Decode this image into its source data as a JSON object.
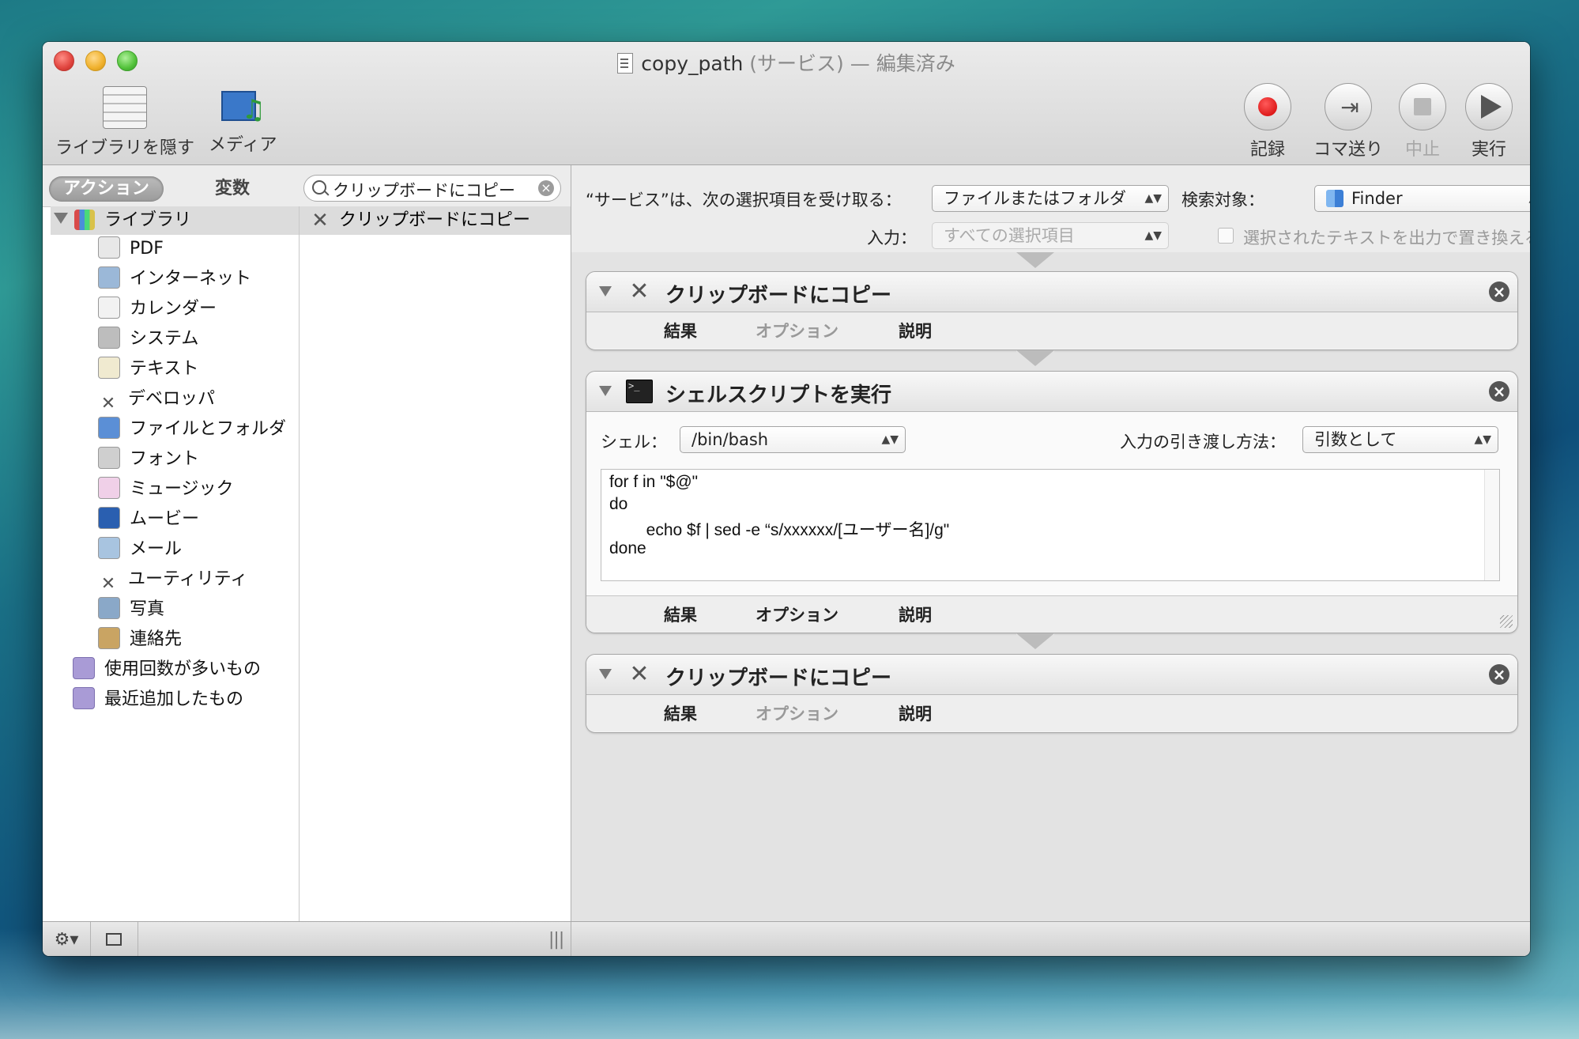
{
  "window": {
    "title": "copy_path",
    "title_suffix": " (サービス) — 編集済み"
  },
  "toolbar": {
    "library_label": "ライブラリを隠す",
    "media_label": "メディア",
    "record_label": "記録",
    "step_label": "コマ送り",
    "stop_label": "中止",
    "run_label": "実行"
  },
  "left_pane": {
    "tab_actions": "アクション",
    "tab_variables": "変数",
    "search_value": "クリップボードにコピー",
    "library_root": "ライブラリ",
    "categories": [
      {
        "label": "PDF",
        "icon": "pdf-icon"
      },
      {
        "label": "インターネット",
        "icon": "internet-icon"
      },
      {
        "label": "カレンダー",
        "icon": "calendar-icon"
      },
      {
        "label": "システム",
        "icon": "system-icon"
      },
      {
        "label": "テキスト",
        "icon": "text-icon"
      },
      {
        "label": "デベロッパ",
        "icon": "developer-icon"
      },
      {
        "label": "ファイルとフォルダ",
        "icon": "finder-icon"
      },
      {
        "label": "フォント",
        "icon": "font-icon"
      },
      {
        "label": "ミュージック",
        "icon": "music-icon"
      },
      {
        "label": "ムービー",
        "icon": "movie-icon"
      },
      {
        "label": "メール",
        "icon": "mail-icon"
      },
      {
        "label": "ユーティリティ",
        "icon": "utility-icon"
      },
      {
        "label": "写真",
        "icon": "photo-icon"
      },
      {
        "label": "連絡先",
        "icon": "contacts-icon"
      }
    ],
    "smart_folders": [
      {
        "label": "使用回数が多いもの",
        "icon": "smart-folder-icon"
      },
      {
        "label": "最近追加したもの",
        "icon": "smart-folder-icon"
      }
    ],
    "results": [
      "クリップボードにコピー"
    ]
  },
  "service_config": {
    "receives_label": "“サービス”は、次の選択項目を受け取る：",
    "receives_value": "ファイルまたはフォルダ",
    "search_target_label": "検索対象：",
    "search_target_value": "Finder",
    "input_label": "入力：",
    "input_value": "すべての選択項目",
    "replace_label": "選択されたテキストを出力で置き換える"
  },
  "workflow": {
    "tab_results": "結果",
    "tab_options": "オプション",
    "tab_description": "説明",
    "actions": [
      {
        "title": "クリップボードにコピー"
      },
      {
        "title": "シェルスクリプトを実行",
        "shell_label": "シェル：",
        "shell_value": "/bin/bash",
        "pass_input_label": "入力の引き渡し方法：",
        "pass_input_value": "引数として",
        "script_lines": [
          "for f in \"$@\"",
          "do",
          "        echo $f | sed -e “s/xxxxxx/[ユーザー名]/g\"",
          "done"
        ]
      },
      {
        "title": "クリップボードにコピー"
      }
    ]
  },
  "bottom_bar": {
    "gear_glyph": "⚙▾",
    "grip_glyph": "|||"
  }
}
